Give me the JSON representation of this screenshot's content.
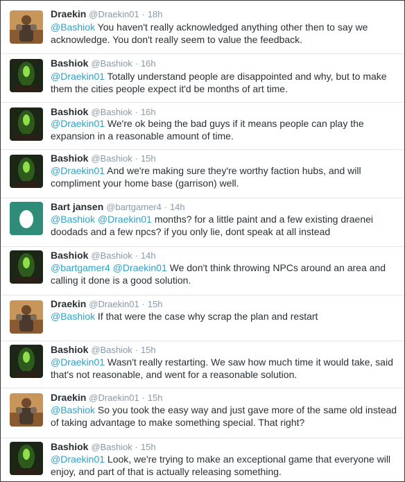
{
  "tweets": [
    {
      "avatar": "draekin-avatar",
      "name": "Draekin",
      "handle": "@Draekin01",
      "time": "18h",
      "mentions": [
        "@Bashiok"
      ],
      "text": "You haven't really acknowledged anything other then to say we acknowledge. You don't really seem to value the feedback."
    },
    {
      "avatar": "bashiok-avatar",
      "name": "Bashiok",
      "handle": "@Bashiok",
      "time": "16h",
      "mentions": [
        "@Draekin01"
      ],
      "text": "Totally understand people are disappointed and why, but to make them the cities people expect it'd be months of art time."
    },
    {
      "avatar": "bashiok-avatar",
      "name": "Bashiok",
      "handle": "@Bashiok",
      "time": "16h",
      "mentions": [
        "@Draekin01"
      ],
      "text": "We're ok being the bad guys if it means people can play the expansion in a reasonable amount of time."
    },
    {
      "avatar": "bashiok-avatar",
      "name": "Bashiok",
      "handle": "@Bashiok",
      "time": "15h",
      "mentions": [
        "@Draekin01"
      ],
      "text": "And we're making sure they're worthy faction hubs, and will compliment your home base (garrison) well."
    },
    {
      "avatar": "egg-avatar",
      "name": "Bart jansen",
      "handle": "@bartgamer4",
      "time": "14h",
      "mentions": [
        "@Bashiok",
        "@Draekin01"
      ],
      "text": "months? for a little paint and a few existing draenei doodads and a few npcs? if you only lie, dont speak at all instead"
    },
    {
      "avatar": "bashiok-avatar",
      "name": "Bashiok",
      "handle": "@Bashiok",
      "time": "14h",
      "mentions": [
        "@bartgamer4",
        "@Draekin01"
      ],
      "text": "We don't think throwing NPCs around an area and calling it done is a good solution."
    },
    {
      "avatar": "draekin-avatar",
      "name": "Draekin",
      "handle": "@Draekin01",
      "time": "15h",
      "mentions": [
        "@Bashiok"
      ],
      "text": "If that were the case why scrap the plan and restart"
    },
    {
      "avatar": "bashiok-avatar",
      "name": "Bashiok",
      "handle": "@Bashiok",
      "time": "15h",
      "mentions": [
        "@Draekin01"
      ],
      "text": "Wasn't really restarting. We saw how much time it would take, said that's not reasonable, and went for a reasonable solution."
    },
    {
      "avatar": "draekin-avatar",
      "name": "Draekin",
      "handle": "@Draekin01",
      "time": "15h",
      "mentions": [
        "@Bashiok"
      ],
      "text": "So you took the easy way and just gave more of the same old instead of taking advantage to make something special. That right?"
    },
    {
      "avatar": "bashiok-avatar",
      "name": "Bashiok",
      "handle": "@Bashiok",
      "time": "15h",
      "mentions": [
        "@Draekin01"
      ],
      "text": "Look, we're trying to make an exceptional game that everyone will enjoy, and part of that is actually releasing something."
    }
  ],
  "separator": "·",
  "colors": {
    "mention": "#2aa3c8",
    "meta": "#8899a6",
    "text": "#292f33"
  }
}
